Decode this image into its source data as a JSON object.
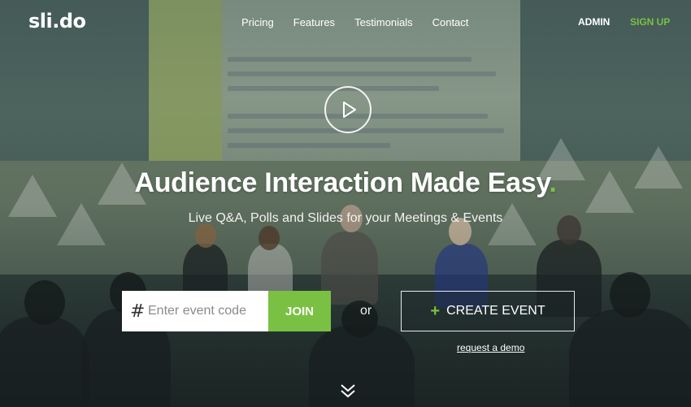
{
  "brand": {
    "logo_text": "sli.do",
    "accent": "#7ac143"
  },
  "nav": {
    "items": [
      {
        "label": "Pricing"
      },
      {
        "label": "Features"
      },
      {
        "label": "Testimonials"
      },
      {
        "label": "Contact"
      }
    ],
    "admin_label": "ADMIN",
    "signup_label": "SIGN UP"
  },
  "hero": {
    "headline": "Audience Interaction Made Easy",
    "headline_dot": ".",
    "subline": "Live Q&A, Polls and Slides for your Meetings & Events"
  },
  "form": {
    "hash_symbol": "#",
    "code_placeholder": "Enter event code",
    "join_label": "JOIN",
    "or_label": "or",
    "create_plus": "+",
    "create_label": "CREATE EVENT",
    "demo_label": "request a demo"
  },
  "icons": {
    "play": "play-icon",
    "scroll": "chevron-double-down-icon"
  }
}
